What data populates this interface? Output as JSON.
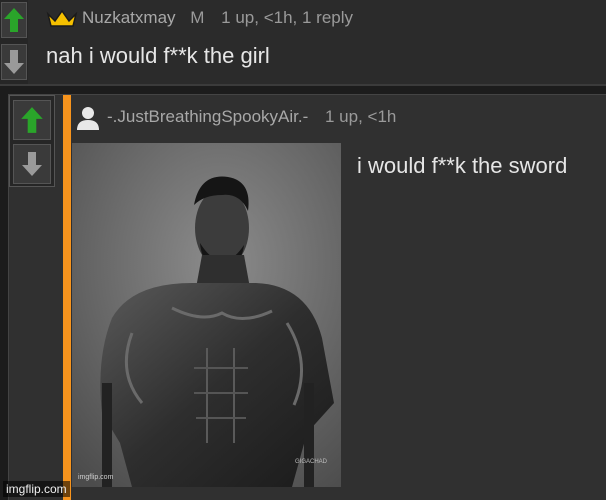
{
  "parent_comment": {
    "author": "Nuzkatxmay",
    "badge": "M",
    "meta": "1 up, <1h, 1 reply",
    "body": "nah i would f**k the girl",
    "icons": [
      "crown-icon",
      "upvote-arrow-icon",
      "downvote-arrow-icon"
    ]
  },
  "reply_comment": {
    "author": "-.JustBreathingSpookyAir.-",
    "meta": "1 up, <1h",
    "body": "i would f**k the sword",
    "image_caption": "imgflip.com",
    "image_tag": "GIGACHAD",
    "icons": [
      "avatar-icon",
      "upvote-arrow-icon",
      "downvote-arrow-icon"
    ]
  },
  "watermark": "imgflip.com",
  "colors": {
    "upvote": "#2aa52a",
    "downvote": "#9a9a9a",
    "thread_line": "#f7941d",
    "crown": "#f5c000"
  }
}
